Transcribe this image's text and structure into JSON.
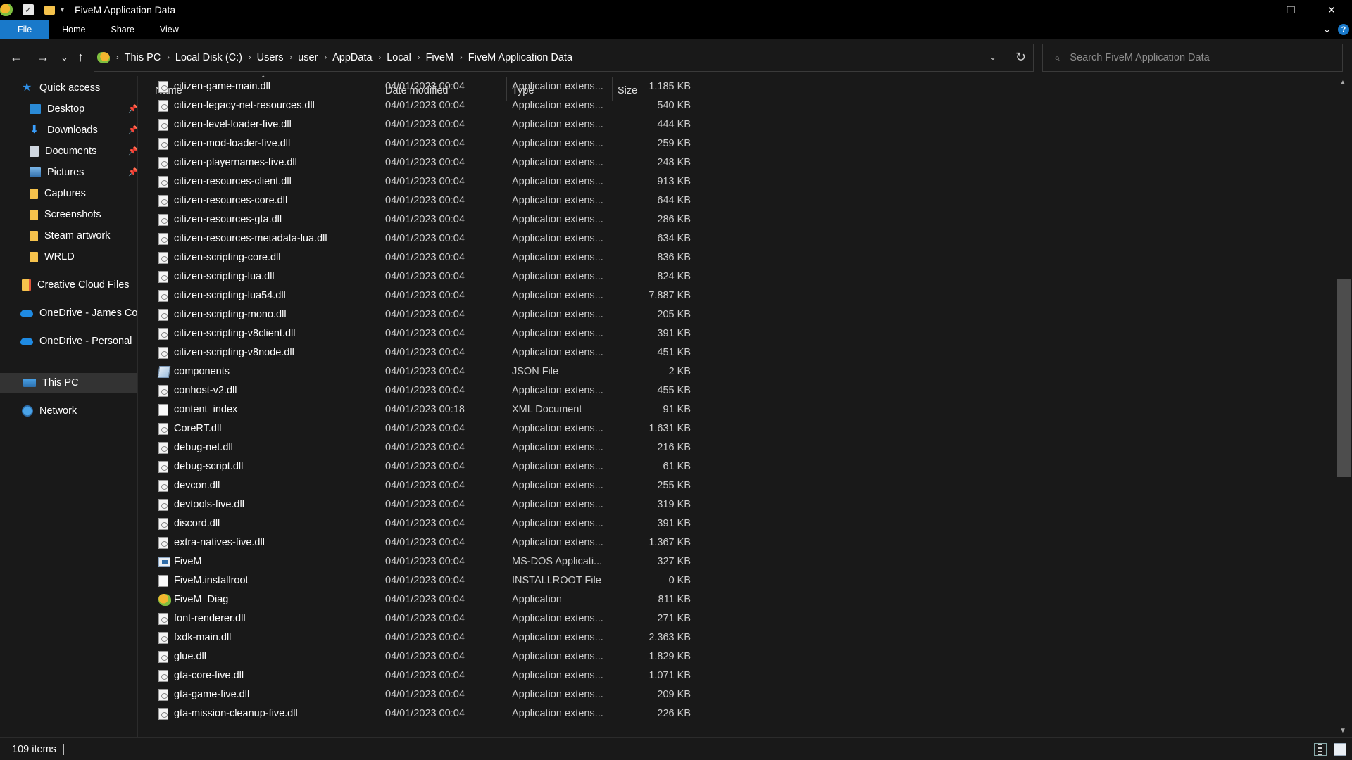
{
  "window": {
    "title": "FiveM Application Data",
    "controls": {
      "minimize": "—",
      "restore": "❐",
      "close": "✕"
    }
  },
  "ribbon": {
    "tabs": [
      "File",
      "Home",
      "Share",
      "View"
    ]
  },
  "nav": {
    "back": "←",
    "forward": "→",
    "recent": "⌄",
    "up": "↑"
  },
  "address": {
    "crumbs": [
      "This PC",
      "Local Disk (C:)",
      "Users",
      "user",
      "AppData",
      "Local",
      "FiveM",
      "FiveM Application Data"
    ]
  },
  "search": {
    "placeholder": "Search FiveM Application Data"
  },
  "sidebar": {
    "items": [
      {
        "label": "Quick access",
        "icon": "star-icon"
      },
      {
        "label": "Desktop",
        "icon": "desktop-icon",
        "pinned": true
      },
      {
        "label": "Downloads",
        "icon": "download-icon",
        "pinned": true
      },
      {
        "label": "Documents",
        "icon": "documents-icon",
        "pinned": true
      },
      {
        "label": "Pictures",
        "icon": "pictures-icon",
        "pinned": true
      },
      {
        "label": "Captures",
        "icon": "folder-icon"
      },
      {
        "label": "Screenshots",
        "icon": "folder-icon"
      },
      {
        "label": "Steam artwork",
        "icon": "folder-icon"
      },
      {
        "label": "WRLD",
        "icon": "folder-icon"
      },
      {
        "label": "Creative Cloud Files",
        "icon": "creative-cloud-icon"
      },
      {
        "label": "OneDrive - James Co",
        "icon": "onedrive-icon"
      },
      {
        "label": "OneDrive - Personal",
        "icon": "onedrive-icon"
      },
      {
        "label": "This PC",
        "icon": "this-pc-icon",
        "selected": true
      },
      {
        "label": "Network",
        "icon": "network-icon"
      }
    ]
  },
  "columns": {
    "name": "Name",
    "date": "Date modified",
    "type": "Type",
    "size": "Size"
  },
  "files": [
    {
      "name": "citizen-game-main.dll",
      "date": "04/01/2023 00:04",
      "type": "Application extens...",
      "size": "1.185 KB",
      "icon": "dll"
    },
    {
      "name": "citizen-legacy-net-resources.dll",
      "date": "04/01/2023 00:04",
      "type": "Application extens...",
      "size": "540 KB",
      "icon": "dll"
    },
    {
      "name": "citizen-level-loader-five.dll",
      "date": "04/01/2023 00:04",
      "type": "Application extens...",
      "size": "444 KB",
      "icon": "dll"
    },
    {
      "name": "citizen-mod-loader-five.dll",
      "date": "04/01/2023 00:04",
      "type": "Application extens...",
      "size": "259 KB",
      "icon": "dll"
    },
    {
      "name": "citizen-playernames-five.dll",
      "date": "04/01/2023 00:04",
      "type": "Application extens...",
      "size": "248 KB",
      "icon": "dll"
    },
    {
      "name": "citizen-resources-client.dll",
      "date": "04/01/2023 00:04",
      "type": "Application extens...",
      "size": "913 KB",
      "icon": "dll"
    },
    {
      "name": "citizen-resources-core.dll",
      "date": "04/01/2023 00:04",
      "type": "Application extens...",
      "size": "644 KB",
      "icon": "dll"
    },
    {
      "name": "citizen-resources-gta.dll",
      "date": "04/01/2023 00:04",
      "type": "Application extens...",
      "size": "286 KB",
      "icon": "dll"
    },
    {
      "name": "citizen-resources-metadata-lua.dll",
      "date": "04/01/2023 00:04",
      "type": "Application extens...",
      "size": "634 KB",
      "icon": "dll"
    },
    {
      "name": "citizen-scripting-core.dll",
      "date": "04/01/2023 00:04",
      "type": "Application extens...",
      "size": "836 KB",
      "icon": "dll"
    },
    {
      "name": "citizen-scripting-lua.dll",
      "date": "04/01/2023 00:04",
      "type": "Application extens...",
      "size": "824 KB",
      "icon": "dll"
    },
    {
      "name": "citizen-scripting-lua54.dll",
      "date": "04/01/2023 00:04",
      "type": "Application extens...",
      "size": "7.887 KB",
      "icon": "dll"
    },
    {
      "name": "citizen-scripting-mono.dll",
      "date": "04/01/2023 00:04",
      "type": "Application extens...",
      "size": "205 KB",
      "icon": "dll"
    },
    {
      "name": "citizen-scripting-v8client.dll",
      "date": "04/01/2023 00:04",
      "type": "Application extens...",
      "size": "391 KB",
      "icon": "dll"
    },
    {
      "name": "citizen-scripting-v8node.dll",
      "date": "04/01/2023 00:04",
      "type": "Application extens...",
      "size": "451 KB",
      "icon": "dll"
    },
    {
      "name": "components",
      "date": "04/01/2023 00:04",
      "type": "JSON File",
      "size": "2 KB",
      "icon": "json"
    },
    {
      "name": "conhost-v2.dll",
      "date": "04/01/2023 00:04",
      "type": "Application extens...",
      "size": "455 KB",
      "icon": "dll"
    },
    {
      "name": "content_index",
      "date": "04/01/2023 00:18",
      "type": "XML Document",
      "size": "91 KB",
      "icon": "blank"
    },
    {
      "name": "CoreRT.dll",
      "date": "04/01/2023 00:04",
      "type": "Application extens...",
      "size": "1.631 KB",
      "icon": "dll"
    },
    {
      "name": "debug-net.dll",
      "date": "04/01/2023 00:04",
      "type": "Application extens...",
      "size": "216 KB",
      "icon": "dll"
    },
    {
      "name": "debug-script.dll",
      "date": "04/01/2023 00:04",
      "type": "Application extens...",
      "size": "61 KB",
      "icon": "dll"
    },
    {
      "name": "devcon.dll",
      "date": "04/01/2023 00:04",
      "type": "Application extens...",
      "size": "255 KB",
      "icon": "dll"
    },
    {
      "name": "devtools-five.dll",
      "date": "04/01/2023 00:04",
      "type": "Application extens...",
      "size": "319 KB",
      "icon": "dll"
    },
    {
      "name": "discord.dll",
      "date": "04/01/2023 00:04",
      "type": "Application extens...",
      "size": "391 KB",
      "icon": "dll"
    },
    {
      "name": "extra-natives-five.dll",
      "date": "04/01/2023 00:04",
      "type": "Application extens...",
      "size": "1.367 KB",
      "icon": "dll"
    },
    {
      "name": "FiveM",
      "date": "04/01/2023 00:04",
      "type": "MS-DOS Applicati...",
      "size": "327 KB",
      "icon": "exe"
    },
    {
      "name": "FiveM.installroot",
      "date": "04/01/2023 00:04",
      "type": "INSTALLROOT File",
      "size": "0 KB",
      "icon": "blank"
    },
    {
      "name": "FiveM_Diag",
      "date": "04/01/2023 00:04",
      "type": "Application",
      "size": "811 KB",
      "icon": "diag"
    },
    {
      "name": "font-renderer.dll",
      "date": "04/01/2023 00:04",
      "type": "Application extens...",
      "size": "271 KB",
      "icon": "dll"
    },
    {
      "name": "fxdk-main.dll",
      "date": "04/01/2023 00:04",
      "type": "Application extens...",
      "size": "2.363 KB",
      "icon": "dll"
    },
    {
      "name": "glue.dll",
      "date": "04/01/2023 00:04",
      "type": "Application extens...",
      "size": "1.829 KB",
      "icon": "dll"
    },
    {
      "name": "gta-core-five.dll",
      "date": "04/01/2023 00:04",
      "type": "Application extens...",
      "size": "1.071 KB",
      "icon": "dll"
    },
    {
      "name": "gta-game-five.dll",
      "date": "04/01/2023 00:04",
      "type": "Application extens...",
      "size": "209 KB",
      "icon": "dll"
    },
    {
      "name": "gta-mission-cleanup-five.dll",
      "date": "04/01/2023 00:04",
      "type": "Application extens...",
      "size": "226 KB",
      "icon": "dll"
    }
  ],
  "status": {
    "count": "109 items"
  }
}
